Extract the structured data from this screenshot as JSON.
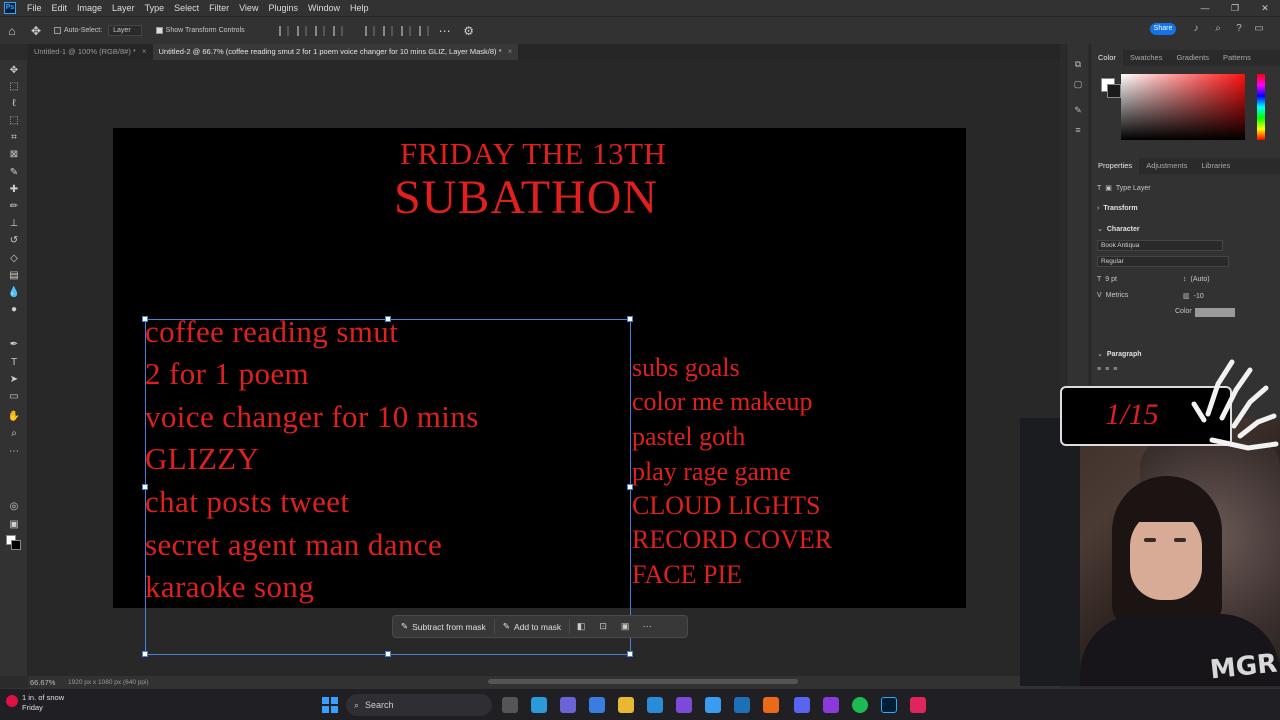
{
  "menu": {
    "logo": "Ps",
    "items": [
      "File",
      "Edit",
      "Image",
      "Layer",
      "Type",
      "Select",
      "Filter",
      "View",
      "Plugins",
      "Window",
      "Help"
    ]
  },
  "window_controls": {
    "minimize": "—",
    "restore": "❐",
    "close": "✕"
  },
  "options": {
    "auto_select_label": "Auto-Select:",
    "auto_select_target": "Layer",
    "transform_controls_label": "Show Transform Controls",
    "share_label": "Share"
  },
  "tabs": [
    {
      "label": "Untitled-1 @ 100% (RGB/8#) *",
      "active": false
    },
    {
      "label": "Untitled-2 @ 66.7% (coffee reading smut 2 for 1 poem voice changer for 10 mins GLIZ, Layer Mask/8) *",
      "active": true
    }
  ],
  "canvas": {
    "title_line1": "FRIDAY THE 13TH",
    "title_line2": "SUBATHON",
    "left_list": [
      "coffee reading smut",
      "2 for 1 poem",
      "voice changer for 10 mins",
      "GLIZZY",
      "chat posts tweet",
      "secret agent man dance",
      "karaoke song"
    ],
    "right_list": [
      "subs goals",
      "color me makeup",
      "pastel goth",
      "play rage game",
      "CLOUD LIGHTS",
      "RECORD COVER",
      "FACE PIE"
    ],
    "text_color": "#e01f1f"
  },
  "context_bar": {
    "subtract_label": "Subtract from mask",
    "add_label": "Add to mask"
  },
  "status": {
    "zoom": "66.67%",
    "dimensions": "1920 px x 1080 px (640 ppi)"
  },
  "panels": {
    "color_tabs": [
      "Color",
      "Swatches",
      "Gradients",
      "Patterns"
    ],
    "property_tabs": [
      "Properties",
      "Adjustments",
      "Libraries"
    ],
    "layer_type": "Type Layer",
    "transform_label": "Transform",
    "character_label": "Character",
    "font_family": "Book Antiqua",
    "font_style": "Regular",
    "font_size": "9 pt",
    "leading": "(Auto)",
    "kerning": "Metrics",
    "tracking": "-10",
    "color_label": "Color",
    "paragraph_label": "Paragraph"
  },
  "overlay": {
    "counter": "1/15",
    "shirt_text": "MGR"
  },
  "taskbar": {
    "weather_line1": "1 in. of snow",
    "weather_line2": "Friday",
    "search_label": "Search"
  }
}
